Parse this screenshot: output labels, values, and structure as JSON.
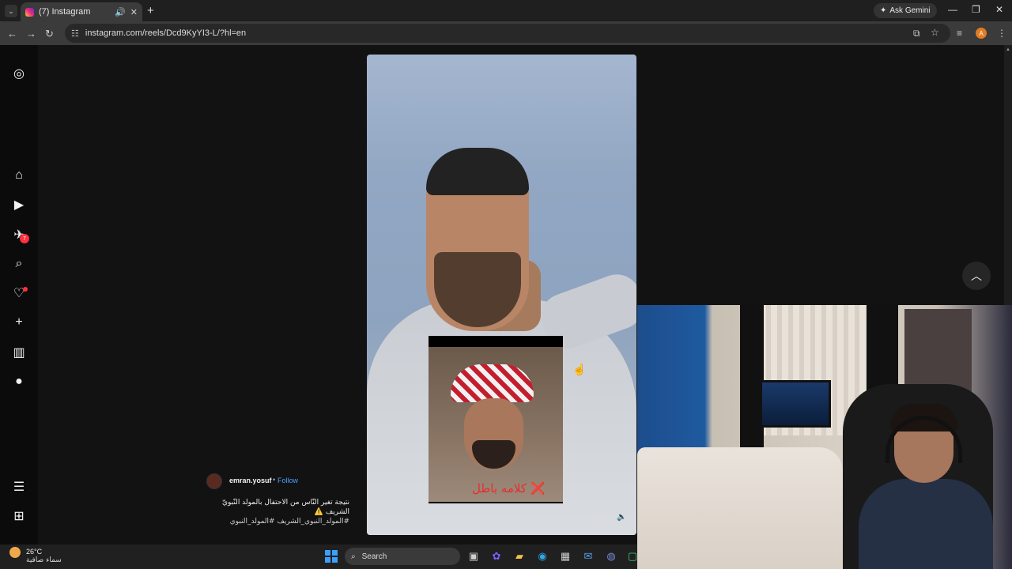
{
  "browser": {
    "tab_title": "(7) Instagram",
    "new_tab": "+",
    "ask_gemini": "Ask Gemini",
    "url": "instagram.com/reels/Dcd9KyYI3-L/?hl=en",
    "profile_initial": "A"
  },
  "sidebar": {
    "messages_badge": "7"
  },
  "post": {
    "username": "emran.yosuf",
    "separator": "•",
    "follow": "Follow",
    "description": "نتيجة تغير النّاس من الاحتفال بالمولد النّبويّ الشريف ⚠️",
    "hashtags": "#المولد_النبوي_الشريف #المولد_النبوي",
    "inset_caption": "كلامه باطل ❌"
  },
  "taskbar": {
    "temperature": "26°C",
    "weather": "سماء صافية",
    "search_label": "Search"
  },
  "colors": {
    "accent_follow": "#4aa0ff",
    "notification": "#ff3040"
  }
}
